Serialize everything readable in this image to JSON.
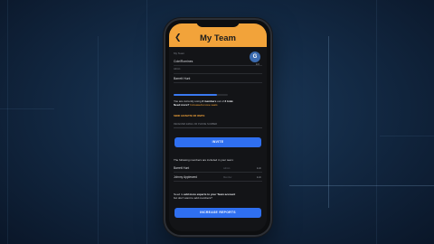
{
  "app": {
    "title": "My Team",
    "back_icon": "chevron-left-icon"
  },
  "team": {
    "section_label": "My Team",
    "owner_name": "Cole/Romines",
    "owner_role": "Admin",
    "second_member": "Barrett Hunt",
    "avatar_letter": "G",
    "avatar_label": "Edit"
  },
  "usage": {
    "progress": 0.8,
    "text_prefix": "You are currently using",
    "text_bold": "3 members",
    "text_mid": "out of",
    "text_total": "3 total.",
    "need_more": "Need more?",
    "link": "Increase/remove seats"
  },
  "invite": {
    "heading": "SEND AN INVITE OR INVITE",
    "placeholder": "RECEIVER EMAIL OR PHONE NUMBER",
    "button": "INVITE"
  },
  "members": {
    "heading": "The following members are included in your team:",
    "list": [
      {
        "name": "Barrett Hunt",
        "role": "Admin",
        "action": "Edit"
      },
      {
        "name": "Johnny Appleseed",
        "role": "Member",
        "action": "Edit"
      }
    ]
  },
  "footer": {
    "text_prefix": "Need to",
    "text_bold": "add more experts to your Team account",
    "text_suffix": "but don't want to add members?",
    "button": "INCREASE REPORTS"
  },
  "colors": {
    "accent": "#f2a33a",
    "primary": "#2f6ff0",
    "background": "#132a45"
  }
}
